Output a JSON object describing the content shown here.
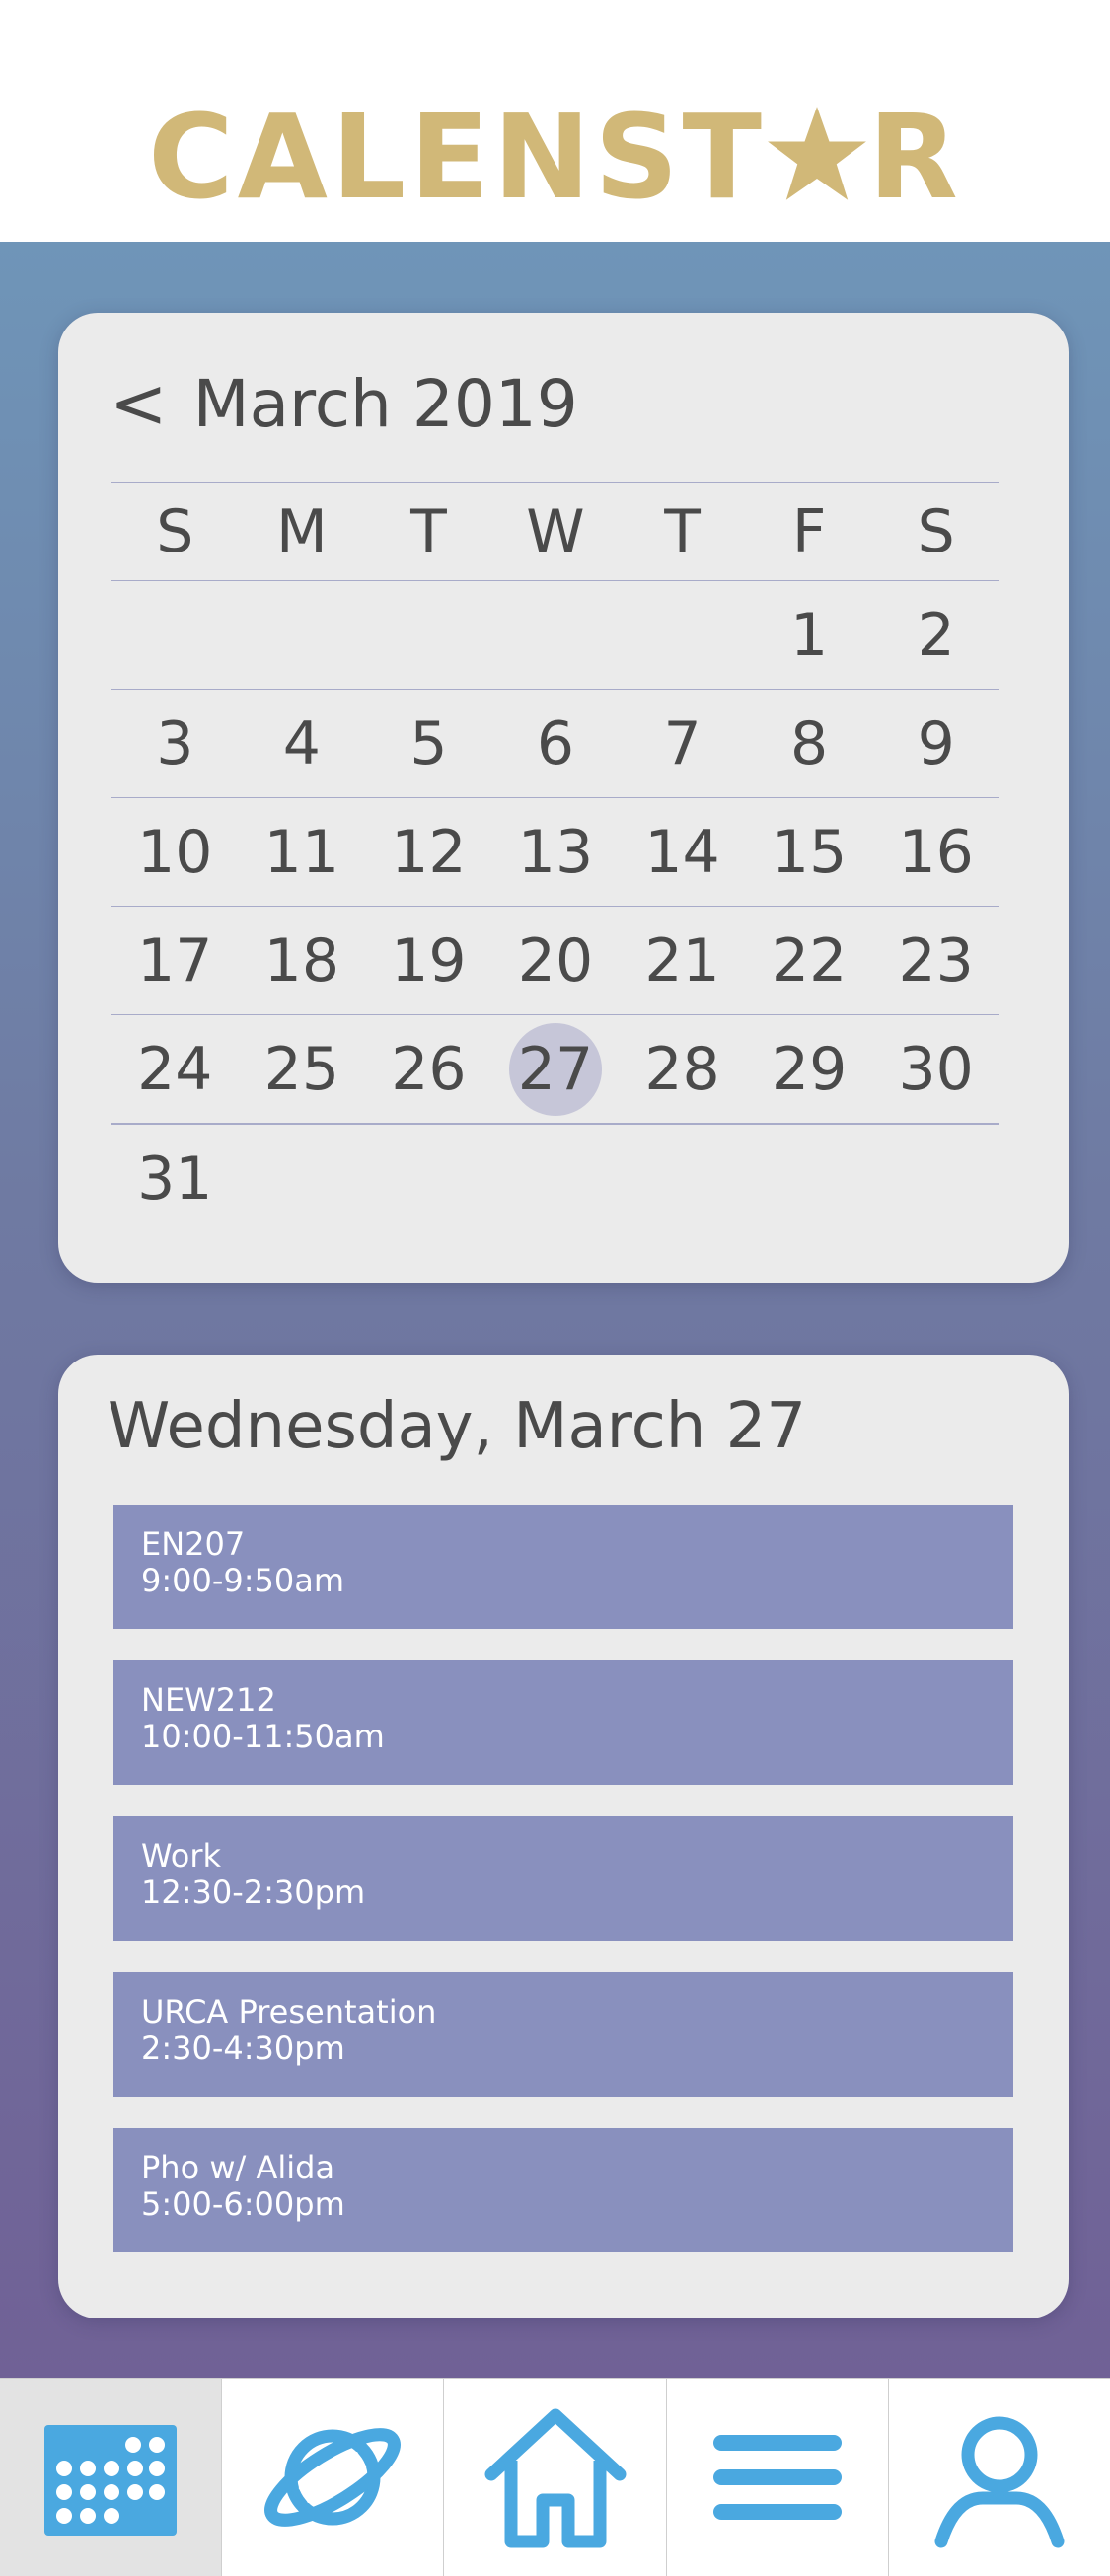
{
  "app": {
    "logo_text_before": "CALENST",
    "logo_text_after": "R",
    "logo_star": "star-icon",
    "brand_color": "#d1b878"
  },
  "calendar": {
    "prev_label": "<",
    "month_title": "March 2019",
    "weekdays": [
      "S",
      "M",
      "T",
      "W",
      "T",
      "F",
      "S"
    ],
    "weeks": [
      [
        "",
        "",
        "",
        "",
        "",
        "1",
        "2"
      ],
      [
        "3",
        "4",
        "5",
        "6",
        "7",
        "8",
        "9"
      ],
      [
        "10",
        "11",
        "12",
        "13",
        "14",
        "15",
        "16"
      ],
      [
        "17",
        "18",
        "19",
        "20",
        "21",
        "22",
        "23"
      ],
      [
        "24",
        "25",
        "26",
        "27",
        "28",
        "29",
        "30"
      ],
      [
        "31",
        "",
        "",
        "",
        "",
        "",
        ""
      ]
    ],
    "selected_day": "27"
  },
  "day": {
    "title": "Wednesday, March 27",
    "events": [
      {
        "name": "EN207",
        "time": "9:00-9:50am"
      },
      {
        "name": "NEW212",
        "time": "10:00-11:50am"
      },
      {
        "name": "Work",
        "time": "12:30-2:30pm"
      },
      {
        "name": "URCA Presentation",
        "time": "2:30-4:30pm"
      },
      {
        "name": "Pho w/ Alida",
        "time": "5:00-6:00pm"
      }
    ]
  },
  "nav": {
    "items": [
      {
        "icon": "calendar-icon",
        "active": true
      },
      {
        "icon": "planet-icon",
        "active": false
      },
      {
        "icon": "home-icon",
        "active": false
      },
      {
        "icon": "menu-icon",
        "active": false
      },
      {
        "icon": "profile-icon",
        "active": false
      }
    ],
    "icon_color": "#4aa8e0"
  },
  "colors": {
    "event_bg": "#8990be",
    "selected_day_bg": "#c6c6d8",
    "card_bg": "#ebebeb"
  }
}
